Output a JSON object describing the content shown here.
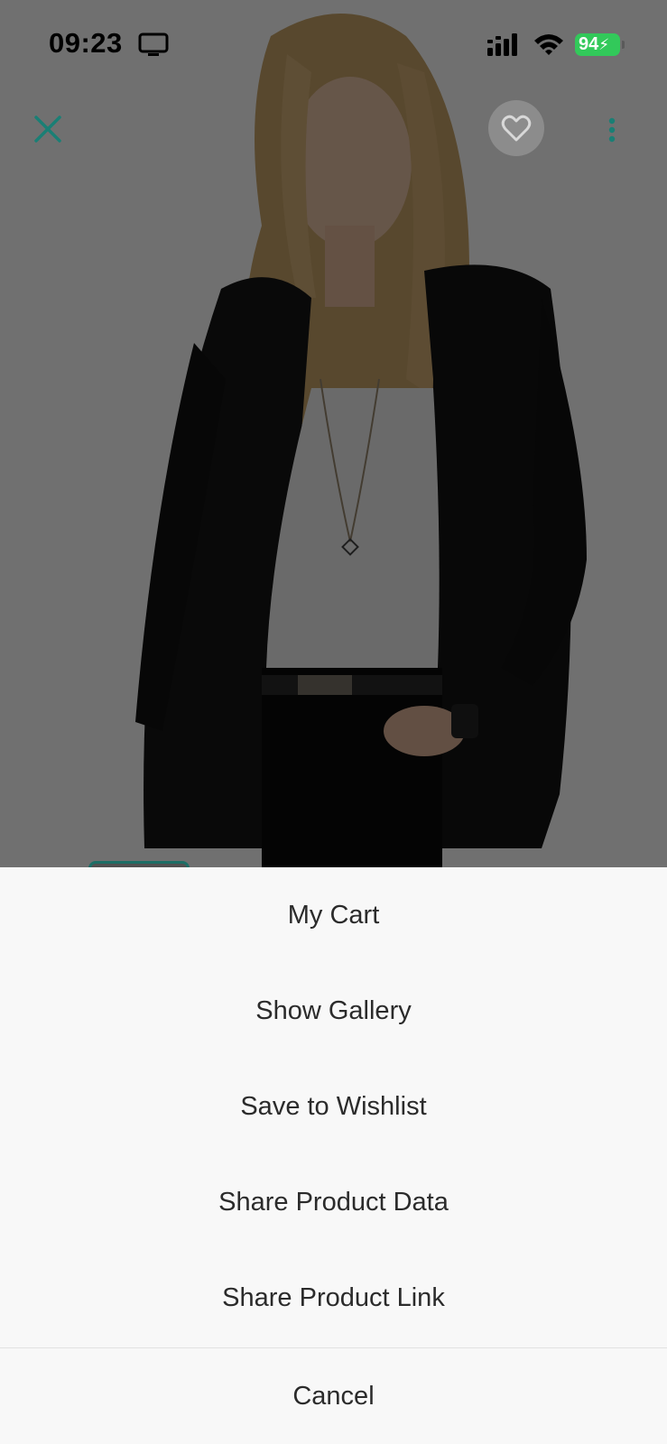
{
  "status_bar": {
    "time": "09:23",
    "battery": "94"
  },
  "icons": {
    "close": "close-icon",
    "favorite": "heart-icon",
    "more": "more-vertical-icon",
    "screen": "screen-mirroring-icon",
    "signal": "cellular-signal-icon",
    "wifi": "wifi-icon",
    "battery_bolt": "charging-bolt-icon"
  },
  "colors": {
    "accent": "#1a7f75",
    "battery": "#32c95a",
    "sheet_background": "#f8f8f8",
    "sheet_text": "#2b2b2b"
  },
  "action_sheet": {
    "items": [
      {
        "label": "My Cart"
      },
      {
        "label": "Show Gallery"
      },
      {
        "label": "Save to Wishlist"
      },
      {
        "label": "Share Product Data"
      },
      {
        "label": "Share Product Link"
      }
    ],
    "cancel_label": "Cancel"
  }
}
